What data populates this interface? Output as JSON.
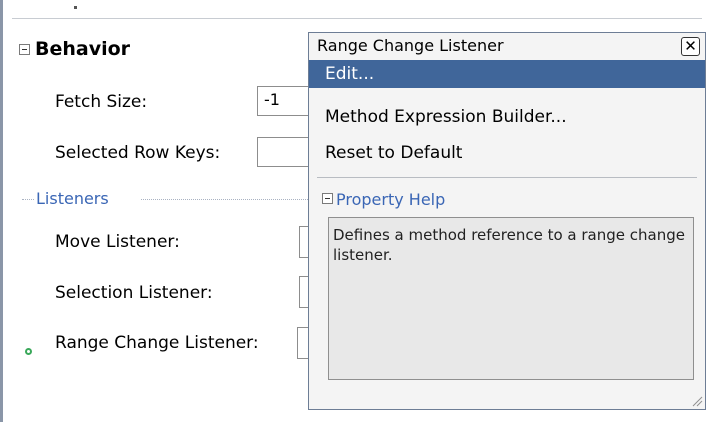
{
  "inspector": {
    "section_title": "Behavior",
    "fetch_size_label": "Fetch Size:",
    "fetch_size_value": "-1",
    "selected_row_keys_label": "Selected Row Keys:",
    "listeners_title": "Listeners",
    "move_listener_label": "Move Listener:",
    "selection_listener_label": "Selection Listener:",
    "range_change_listener_label": "Range Change Listener:"
  },
  "popup": {
    "title": "Range Change Listener",
    "close_glyph": "✕",
    "menu": {
      "edit": "Edit...",
      "method_expression_builder": "Method Expression Builder...",
      "reset_to_default": "Reset to Default"
    },
    "help_header": "Property Help",
    "help_text": "Defines a method reference to a range change listener."
  },
  "colors": {
    "selected_bg": "#40669a",
    "link_blue": "#3a66b5",
    "status_green": "#3aa85a"
  }
}
